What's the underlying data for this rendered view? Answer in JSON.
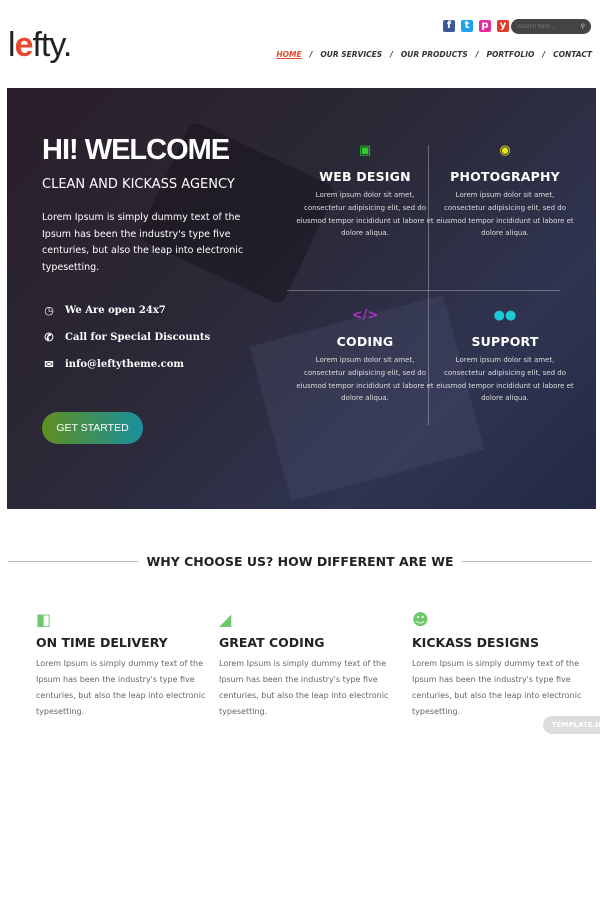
{
  "header": {
    "logo": {
      "pre": "l",
      "accent": "e",
      "post": "fty."
    },
    "social": [
      {
        "name": "facebook-icon",
        "glyph": "f",
        "color": "#3b5998"
      },
      {
        "name": "twitter-icon",
        "glyph": "t",
        "color": "#1da1f2"
      },
      {
        "name": "pinterest-icon",
        "glyph": "p",
        "color": "#e52d9b"
      },
      {
        "name": "youtube-icon",
        "glyph": "y",
        "color": "#e33b2a"
      }
    ],
    "search_placeholder": "Search here ...",
    "nav": [
      "HOME",
      "OUR SERVICES",
      "OUR PRODUCTS",
      "PORTFOLIO",
      "CONTACT"
    ],
    "accent": "#e8492e"
  },
  "hero": {
    "title": "HI! WELCOME",
    "subtitle": "CLEAN AND KICKASS AGENCY",
    "intro": "Lorem Ipsum is simply dummy text of the Ipsum has been the industry's type five centuries, but also the leap into electronic typesetting.",
    "contacts": [
      {
        "icon": "clock-icon",
        "text": "We Are open 24x7"
      },
      {
        "icon": "phone-icon",
        "text": "Call for Special Discounts"
      },
      {
        "icon": "mail-icon",
        "text": "info@leftytheme.com"
      }
    ],
    "cta": "GET STARTED",
    "services": [
      {
        "title": "WEB DESIGN",
        "icon": "monitor-icon",
        "color": "#2ecc2e",
        "text": "Lorem ipsum dolor sit amet, consectetur adipisicing elit, sed do eiusmod tempor incididunt ut labore et dolore aliqua."
      },
      {
        "title": "PHOTOGRAPHY",
        "icon": "camera-icon",
        "color": "#e6e61a",
        "text": "Lorem ipsum dolor sit amet, consectetur adipisicing elit, sed do eiusmod tempor incididunt ut labore et dolore aliqua."
      },
      {
        "title": "CODING",
        "icon": "code-icon",
        "color": "#b030d0",
        "text": "Lorem ipsum dolor sit amet, consectetur adipisicing elit, sed do eiusmod tempor incididunt ut labore et dolore aliqua."
      },
      {
        "title": "SUPPORT",
        "icon": "chat-icon",
        "color": "#1ec8d8",
        "text": "Lorem ipsum dolor sit amet, consectetur adipisicing elit, sed do eiusmod tempor incididunt ut labore et dolore aliqua."
      }
    ]
  },
  "why": {
    "heading": "WHY CHOOSE US? HOW DIFFERENT ARE WE",
    "features": [
      {
        "title": "ON TIME DELIVERY",
        "icon": "document-icon",
        "text": "Lorem Ipsum is simply dummy text of the Ipsum has been the industry's type five centuries, but also the leap into electronic typesetting."
      },
      {
        "title": "GREAT CODING",
        "icon": "area-chart-icon",
        "text": "Lorem Ipsum is simply dummy text of the Ipsum has been the industry's type five centuries, but also the leap into electronic typesetting."
      },
      {
        "title": "KICKASS DESIGNS",
        "icon": "team-icon",
        "text": "Lorem Ipsum is simply dummy text of the Ipsum has been the industry's type five centuries, but also the leap into electronic typesetting."
      }
    ]
  },
  "watermark": "TEMPLATE.N"
}
